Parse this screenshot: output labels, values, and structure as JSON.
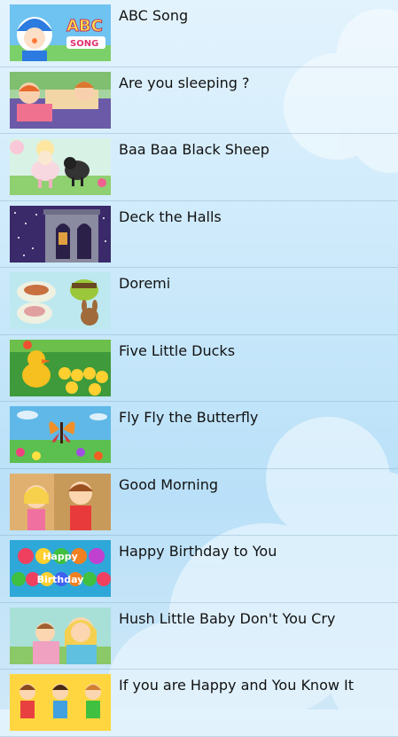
{
  "songs": [
    {
      "title": "ABC Song",
      "thumb": "abc-song-thumbnail"
    },
    {
      "title": "Are you sleeping ?",
      "thumb": "are-you-sleeping-thumbnail"
    },
    {
      "title": "Baa Baa Black Sheep",
      "thumb": "baa-baa-black-sheep-thumbnail"
    },
    {
      "title": "Deck the Halls",
      "thumb": "deck-the-halls-thumbnail"
    },
    {
      "title": "Doremi",
      "thumb": "doremi-thumbnail"
    },
    {
      "title": "Five Little Ducks",
      "thumb": "five-little-ducks-thumbnail"
    },
    {
      "title": "Fly Fly the Butterfly",
      "thumb": "fly-fly-the-butterfly-thumbnail"
    },
    {
      "title": "Good Morning",
      "thumb": "good-morning-thumbnail"
    },
    {
      "title": "Happy Birthday to You",
      "thumb": "happy-birthday-thumbnail"
    },
    {
      "title": "Hush Little Baby Don't You Cry",
      "thumb": "hush-little-baby-thumbnail"
    },
    {
      "title": "If you are Happy and You Know It",
      "thumb": "if-you-are-happy-thumbnail"
    }
  ],
  "thumb_text": {
    "abc_line1": "ABC",
    "abc_line2": "SONG",
    "hb_line1": "Happy",
    "hb_line2": "Birthday"
  },
  "colors": {
    "background": "#cdeafb",
    "text": "#111111",
    "divider": "#8fb0c8"
  }
}
